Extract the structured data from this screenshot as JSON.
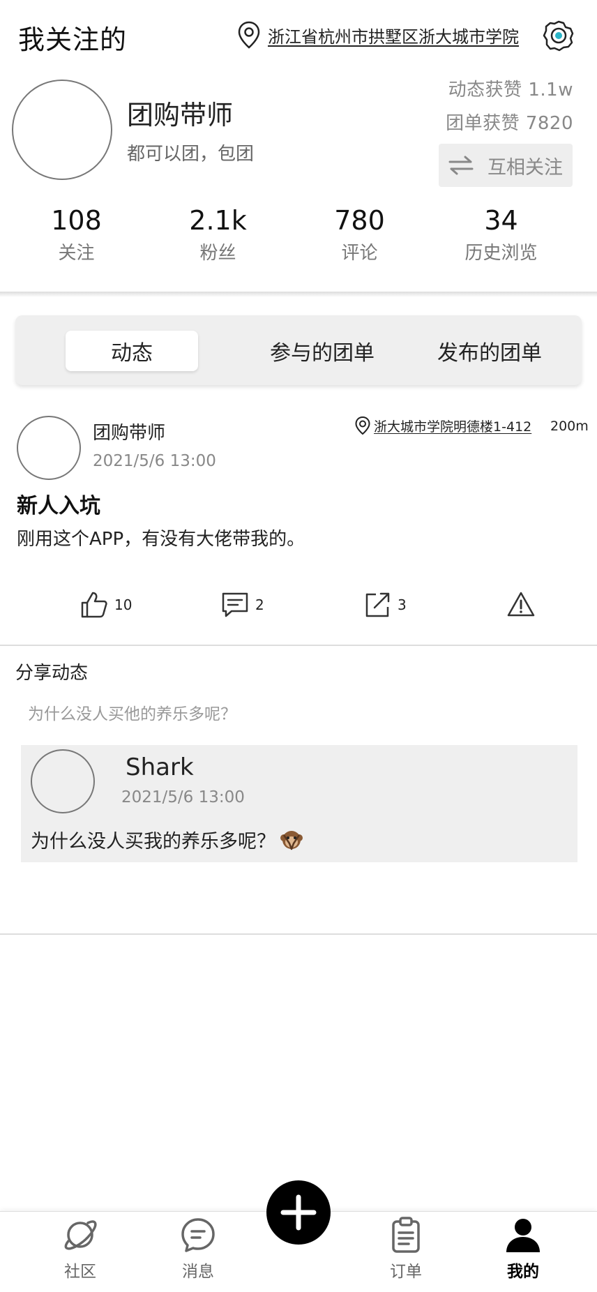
{
  "header": {
    "title": "我关注的",
    "location": "浙江省杭州市拱墅区浙大城市学院",
    "icons": {
      "location": "map-pin-icon",
      "settings": "gear-icon"
    }
  },
  "profile": {
    "name": "团购带师",
    "bio": "都可以团，包团",
    "post_likes": "动态获赞 1.1w",
    "group_likes": "团单获赞 7820",
    "follow_button": "互相关注",
    "stats": [
      {
        "value": "108",
        "label": "关注"
      },
      {
        "value": "2.1k",
        "label": "粉丝"
      },
      {
        "value": "780",
        "label": "评论"
      },
      {
        "value": "34",
        "label": "历史浏览"
      }
    ]
  },
  "tabs": [
    {
      "label": "动态",
      "active": true
    },
    {
      "label": "参与的团单",
      "active": false
    },
    {
      "label": "发布的团单",
      "active": false
    }
  ],
  "post": {
    "author": "团购带师",
    "time": "2021/5/6  13:00",
    "location": "浙大城市学院明德楼1-412",
    "distance": "200m",
    "title": "新人入坑",
    "body": "刚用这个APP，有没有大佬带我的。",
    "actions": {
      "likes": "10",
      "comments": "2",
      "shares": "3"
    }
  },
  "share": {
    "title": "分享动态",
    "caption": "为什么没人买他的养乐多呢？",
    "original": {
      "author": "Shark",
      "time": "2021/5/6  13:00",
      "text": "为什么没人买我的养乐多呢？",
      "emoji": "monkey-emoji"
    }
  },
  "nav": {
    "items": [
      {
        "label": "社区",
        "icon": "planet-icon"
      },
      {
        "label": "消息",
        "icon": "message-icon"
      },
      {
        "label": "订单",
        "icon": "clipboard-icon"
      },
      {
        "label": "我的",
        "icon": "user-icon",
        "active": true
      }
    ],
    "fab_icon": "plus-icon"
  },
  "colors": {
    "accent_settings": "#2bb5c8",
    "tab_background": "#efefef",
    "card_background": "#efefef",
    "fab": "#000000"
  }
}
